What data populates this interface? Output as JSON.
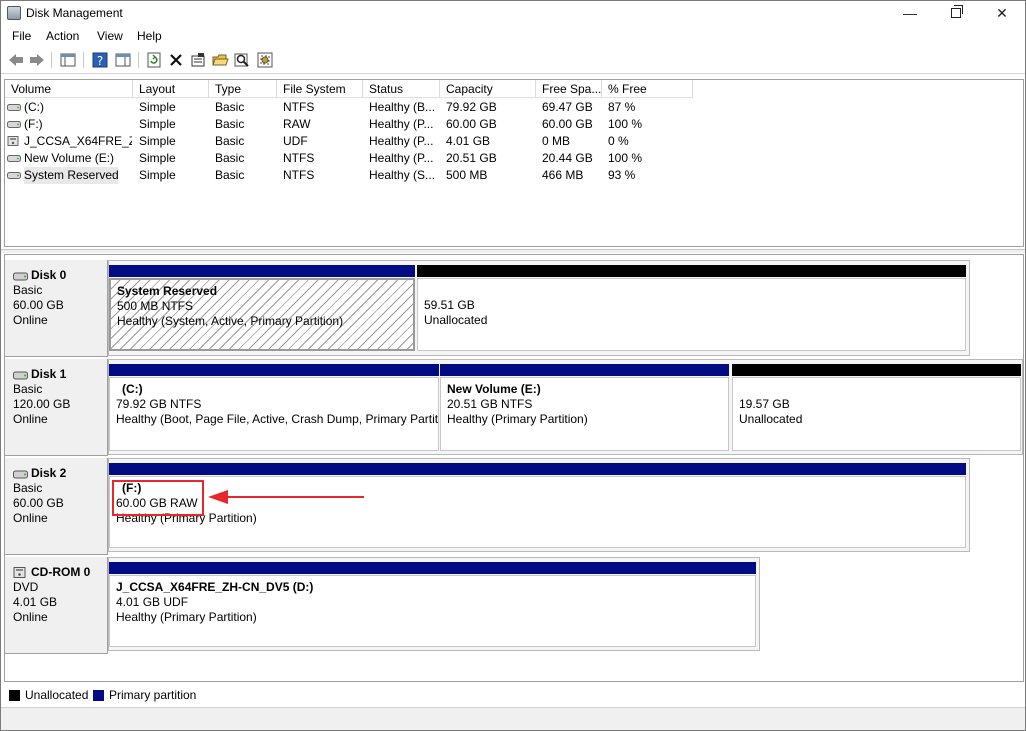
{
  "window": {
    "title": "Disk Management"
  },
  "menu": [
    "File",
    "Action",
    "View",
    "Help"
  ],
  "volume_list": {
    "columns": [
      "Volume",
      "Layout",
      "Type",
      "File System",
      "Status",
      "Capacity",
      "Free Spa...",
      "% Free"
    ],
    "rows": [
      {
        "volume": "(C:)",
        "layout": "Simple",
        "type": "Basic",
        "fs": "NTFS",
        "status": "Healthy (B...",
        "capacity": "79.92 GB",
        "free": "69.47 GB",
        "pct": "87 %",
        "icon": "drive-icon"
      },
      {
        "volume": "(F:)",
        "layout": "Simple",
        "type": "Basic",
        "fs": "RAW",
        "status": "Healthy (P...",
        "capacity": "60.00 GB",
        "free": "60.00 GB",
        "pct": "100 %",
        "icon": "drive-icon"
      },
      {
        "volume": "J_CCSA_X64FRE_Z...",
        "layout": "Simple",
        "type": "Basic",
        "fs": "UDF",
        "status": "Healthy (P...",
        "capacity": "4.01 GB",
        "free": "0 MB",
        "pct": "0 %",
        "icon": "cd-drive-icon"
      },
      {
        "volume": "New Volume (E:)",
        "layout": "Simple",
        "type": "Basic",
        "fs": "NTFS",
        "status": "Healthy (P...",
        "capacity": "20.51 GB",
        "free": "20.44 GB",
        "pct": "100 %",
        "icon": "drive-icon"
      },
      {
        "volume": "System Reserved",
        "layout": "Simple",
        "type": "Basic",
        "fs": "NTFS",
        "status": "Healthy (S...",
        "capacity": "500 MB",
        "free": "466 MB",
        "pct": "93 %",
        "icon": "drive-icon"
      }
    ]
  },
  "disks": [
    {
      "name": "Disk 0",
      "type": "Basic",
      "size": "60.00 GB",
      "state": "Online",
      "partitions": [
        {
          "label": "System Reserved",
          "size": "500 MB NTFS",
          "status": "Healthy (System, Active, Primary Partition)",
          "kind": "primary"
        },
        {
          "label": "",
          "size": "59.51 GB",
          "status": "Unallocated",
          "kind": "unallocated"
        }
      ]
    },
    {
      "name": "Disk 1",
      "type": "Basic",
      "size": "120.00 GB",
      "state": "Online",
      "partitions": [
        {
          "label": "(C:)",
          "size": "79.92 GB NTFS",
          "status": "Healthy (Boot, Page File, Active, Crash Dump, Primary Partit",
          "kind": "primary"
        },
        {
          "label": "New Volume  (E:)",
          "size": "20.51 GB NTFS",
          "status": "Healthy (Primary Partition)",
          "kind": "primary"
        },
        {
          "label": "",
          "size": "19.57 GB",
          "status": "Unallocated",
          "kind": "unallocated"
        }
      ]
    },
    {
      "name": "Disk 2",
      "type": "Basic",
      "size": "60.00 GB",
      "state": "Online",
      "partitions": [
        {
          "label": "(F:)",
          "size": "60.00 GB RAW",
          "status": "Healthy (Primary Partition)",
          "kind": "primary"
        }
      ]
    },
    {
      "name": "CD-ROM 0",
      "type": "DVD",
      "size": "4.01 GB",
      "state": "Online",
      "partitions": [
        {
          "label": "J_CCSA_X64FRE_ZH-CN_DV5  (D:)",
          "size": "4.01 GB UDF",
          "status": "Healthy (Primary Partition)",
          "kind": "primary"
        }
      ]
    }
  ],
  "legend": [
    {
      "label": "Unallocated",
      "color": "#000000"
    },
    {
      "label": "Primary partition",
      "color": "#010c84"
    }
  ],
  "colors": {
    "primary": "#010c84",
    "unallocated": "#000000",
    "annotation": "#e8272b"
  }
}
